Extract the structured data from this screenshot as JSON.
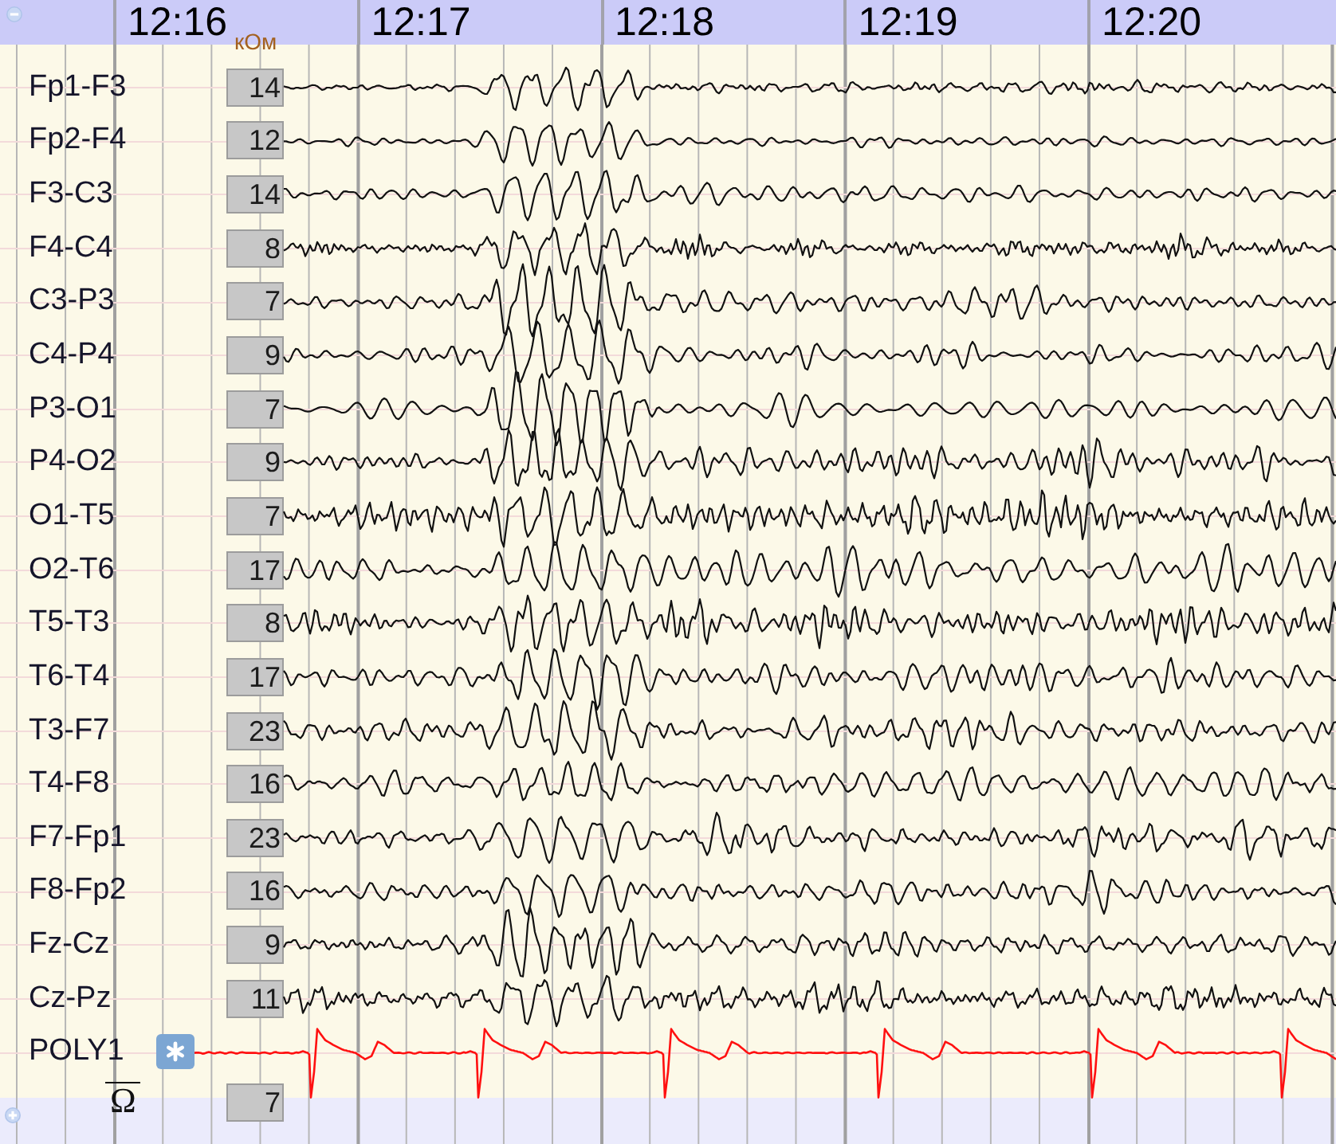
{
  "header": {
    "times": [
      "12:16",
      "12:17",
      "12:18",
      "12:19",
      "12:20"
    ]
  },
  "impedance_unit": "кОм",
  "channels": [
    {
      "label": "Fp1-F3",
      "impedance": "14"
    },
    {
      "label": "Fp2-F4",
      "impedance": "12"
    },
    {
      "label": "F3-C3",
      "impedance": "14"
    },
    {
      "label": "F4-C4",
      "impedance": "8"
    },
    {
      "label": "C3-P3",
      "impedance": "7"
    },
    {
      "label": "C4-P4",
      "impedance": "9"
    },
    {
      "label": "P3-O1",
      "impedance": "7"
    },
    {
      "label": "P4-O2",
      "impedance": "9"
    },
    {
      "label": "O1-T5",
      "impedance": "7"
    },
    {
      "label": "O2-T6",
      "impedance": "17"
    },
    {
      "label": "T5-T3",
      "impedance": "8"
    },
    {
      "label": "T6-T4",
      "impedance": "17"
    },
    {
      "label": "T3-F7",
      "impedance": "23"
    },
    {
      "label": "T4-F8",
      "impedance": "16"
    },
    {
      "label": "F7-Fp1",
      "impedance": "23"
    },
    {
      "label": "F8-Fp2",
      "impedance": "16"
    },
    {
      "label": "Fz-Cz",
      "impedance": "9"
    },
    {
      "label": "Cz-Pz",
      "impedance": "11"
    }
  ],
  "poly_channel": {
    "label": "POLY1"
  },
  "mean_impedance": {
    "symbol": "Ω",
    "value": "7"
  }
}
